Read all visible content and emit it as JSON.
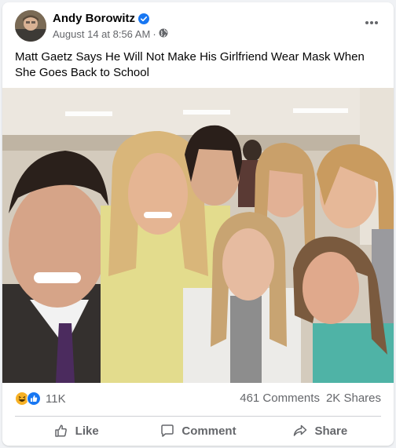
{
  "post": {
    "author": "Andy Borowitz",
    "timestamp": "August 14 at 8:56 AM",
    "audience_icon": "globe-icon",
    "text": "Matt Gaetz Says He Will Not Make His Girlfriend Wear Mask When She Goes Back to School"
  },
  "stats": {
    "reaction_icons": [
      "laugh-reaction-icon",
      "like-reaction-icon"
    ],
    "reactions": "11K",
    "comments": "461 Comments",
    "shares": "2K Shares"
  },
  "actions": {
    "like": "Like",
    "comment": "Comment",
    "share": "Share"
  },
  "colors": {
    "verified": "#1877f2",
    "secondary_text": "#65676b",
    "laugh": "#f7b125",
    "like": "#1877f2"
  }
}
